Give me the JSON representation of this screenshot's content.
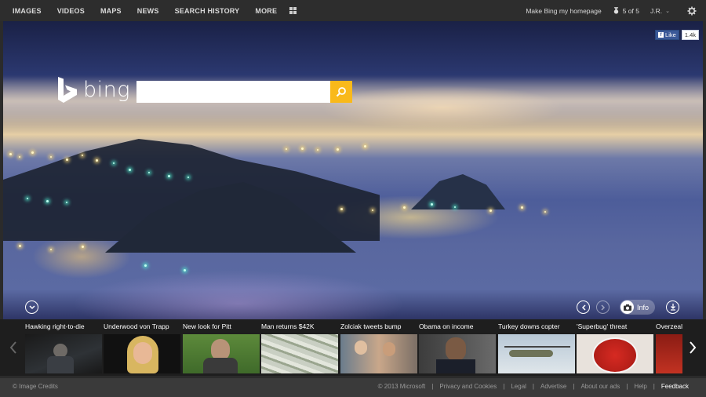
{
  "nav": {
    "items": [
      "IMAGES",
      "VIDEOS",
      "MAPS",
      "NEWS",
      "SEARCH HISTORY",
      "MORE"
    ]
  },
  "account": {
    "homepage_link": "Make Bing my homepage",
    "rewards": "5 of 5",
    "user": "J.R."
  },
  "logo": {
    "text": "bing"
  },
  "search": {
    "value": "",
    "placeholder": ""
  },
  "facebook": {
    "like_label": "Like",
    "count": "1.4k"
  },
  "hero_controls": {
    "info_label": "Info"
  },
  "news": [
    {
      "title": "Hawking right-to-die",
      "icon": "person-wheelchair"
    },
    {
      "title": "Underwood von Trapp",
      "icon": "blonde-singer"
    },
    {
      "title": "New look for Pitt",
      "icon": "man-in-park"
    },
    {
      "title": "Man returns $42K",
      "icon": "dollar-bills"
    },
    {
      "title": "Zolciak tweets bump",
      "icon": "family-photo"
    },
    {
      "title": "Obama on income",
      "icon": "president-portrait"
    },
    {
      "title": "Turkey downs copter",
      "icon": "military-helicopter"
    },
    {
      "title": "'Superbug' threat",
      "icon": "petri-dish"
    },
    {
      "title": "Overzeal",
      "icon": "red-image"
    }
  ],
  "footer": {
    "credits": "© Image Credits",
    "copyright": "© 2013 Microsoft",
    "links": [
      "Privacy and Cookies",
      "Legal",
      "Advertise",
      "About our ads",
      "Help"
    ],
    "feedback": "Feedback"
  },
  "colors": {
    "accent_search": "#f9b91a",
    "topbar": "#2d2d2d",
    "carousel": "#1e1e1e",
    "footer": "#3a3a3a",
    "facebook": "#3b5998"
  }
}
